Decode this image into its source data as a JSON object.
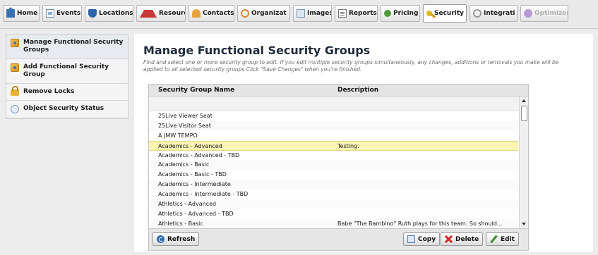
{
  "tabs": [
    {
      "name": "tab-home",
      "label": "Home",
      "icon": "home-icon",
      "state": "normal"
    },
    {
      "name": "tab-events",
      "label": "Events",
      "icon": "events-icon",
      "state": "normal"
    },
    {
      "name": "tab-locations",
      "label": "Locations",
      "icon": "location-icon",
      "state": "normal"
    },
    {
      "name": "tab-resources",
      "label": "Resource",
      "icon": "resource-icon",
      "state": "normal"
    },
    {
      "name": "tab-contacts",
      "label": "Contacts",
      "icon": "contacts-icon",
      "state": "normal"
    },
    {
      "name": "tab-organizations",
      "label": "Organizat",
      "icon": "organization-icon",
      "state": "normal"
    },
    {
      "name": "tab-images",
      "label": "Images",
      "icon": "images-icon",
      "state": "normal"
    },
    {
      "name": "tab-reports",
      "label": "Reports",
      "icon": "reports-icon",
      "state": "normal"
    },
    {
      "name": "tab-pricing",
      "label": "Pricing",
      "icon": "pricing-icon",
      "state": "normal"
    },
    {
      "name": "tab-security",
      "label": "Security",
      "icon": "security-key-icon",
      "state": "active"
    },
    {
      "name": "tab-integration",
      "label": "Integrati",
      "icon": "integration-icon",
      "state": "normal"
    },
    {
      "name": "tab-optimizer",
      "label": "Optimizer",
      "icon": "optimizer-icon",
      "state": "disabled"
    }
  ],
  "sidebar": {
    "items": [
      {
        "label": "Manage Functional Security Groups",
        "icon": "security-group-icon",
        "selected": true
      },
      {
        "label": "Add Functional Security Group",
        "icon": "security-group-icon",
        "selected": false
      },
      {
        "label": "Remove Locks",
        "icon": "lock-icon",
        "selected": false
      },
      {
        "label": "Object Security Status",
        "icon": "shield-icon",
        "selected": false
      }
    ]
  },
  "main": {
    "title": "Manage Functional Security Groups",
    "description": "Find and select one or more security group to edit. If you edit multiple security groups simultaneously, any changes, additions or removals you make will be applied to all selected security groups Click \"Save Changes\" when you're finished."
  },
  "grid": {
    "columns": [
      "Security Group Name",
      "Description"
    ],
    "rows": [
      {
        "name": "25Live Viewer Seat",
        "description": ""
      },
      {
        "name": "25Live Visitor Seat",
        "description": ""
      },
      {
        "name": "A JMW TEMPO",
        "description": ""
      },
      {
        "name": "Academics - Advanced",
        "description": "Testing.",
        "selected": true
      },
      {
        "name": "Academics - Advanced - TBD",
        "description": ""
      },
      {
        "name": "Academics - Basic",
        "description": ""
      },
      {
        "name": "Academics - Basic - TBD",
        "description": ""
      },
      {
        "name": "Academics - Intermediate",
        "description": ""
      },
      {
        "name": "Academics - Intermediate - TBD",
        "description": ""
      },
      {
        "name": "Athletics - Advanced",
        "description": ""
      },
      {
        "name": "Athletics - Advanced - TBD",
        "description": ""
      },
      {
        "name": "Athletics - Basic",
        "description": "Babe \"The Bambino\" Ruth plays for this team. So should..."
      }
    ],
    "buttons": {
      "refresh": "Refresh",
      "copy": "Copy",
      "delete": "Delete",
      "edit": "Edit"
    }
  },
  "colors": {
    "selected_row": "#fbf4b3",
    "title": "#1f2b3a",
    "accent": "#2f6cb5"
  }
}
